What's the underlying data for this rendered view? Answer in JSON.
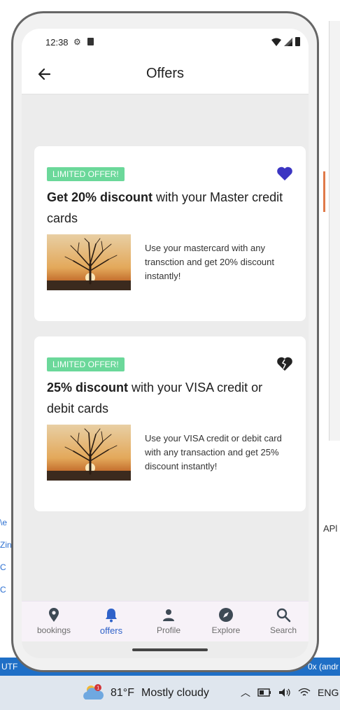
{
  "background": {
    "statusbar_left": "UTF",
    "statusbar_right": "0x (andr",
    "right_label": "APl",
    "left_labels": [
      "\\e",
      "Zin",
      "C",
      "C"
    ]
  },
  "taskbar": {
    "temperature": "81°F",
    "weather": "Mostly cloudy",
    "weather_badge": "1",
    "language": "ENG"
  },
  "status": {
    "time": "12:38"
  },
  "app": {
    "title": "Offers"
  },
  "offers": [
    {
      "badge": "LIMITED OFFER!",
      "title_bold": "Get 20% discount",
      "title_rest": " with your Master credit cards",
      "description": "Use your mastercard with any transction and get 20% discount instantly!",
      "favorite": true
    },
    {
      "badge": "LIMITED OFFER!",
      "title_bold": "25% discount",
      "title_rest": " with your VISA credit or debit cards",
      "description": "Use your  VISA credit or debit card with any transaction and get 25% discount instantly!",
      "favorite": false
    }
  ],
  "nav": [
    {
      "label": "bookings",
      "icon": "location-pin-icon"
    },
    {
      "label": "offers",
      "icon": "bell-icon",
      "active": true
    },
    {
      "label": "Profile",
      "icon": "person-icon"
    },
    {
      "label": "Explore",
      "icon": "compass-icon"
    },
    {
      "label": "Search",
      "icon": "search-icon"
    }
  ],
  "colors": {
    "badge": "#6bd89a",
    "favorite": "#3b35c2",
    "active_nav": "#2f62c9"
  }
}
